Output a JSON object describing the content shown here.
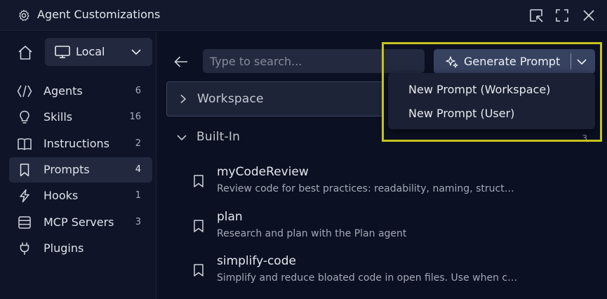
{
  "window": {
    "title": "Agent Customizations"
  },
  "sidebar": {
    "scope_label": "Local",
    "items": [
      {
        "label": "Agents",
        "count": "6",
        "icon": "agents-icon"
      },
      {
        "label": "Skills",
        "count": "16",
        "icon": "lightbulb-icon"
      },
      {
        "label": "Instructions",
        "count": "2",
        "icon": "book-icon"
      },
      {
        "label": "Prompts",
        "count": "4",
        "icon": "bookmark-icon",
        "active": true
      },
      {
        "label": "Hooks",
        "count": "1",
        "icon": "lightning-icon"
      },
      {
        "label": "MCP Servers",
        "count": "3",
        "icon": "server-icon"
      },
      {
        "label": "Plugins",
        "count": "",
        "icon": "plug-icon"
      }
    ]
  },
  "search": {
    "placeholder": "Type to search...",
    "value": ""
  },
  "generate_button": {
    "label": "Generate Prompt"
  },
  "dropdown_menu": {
    "items": [
      "New Prompt (Workspace)",
      "New Prompt (User)"
    ]
  },
  "groups": {
    "workspace": {
      "label": "Workspace"
    },
    "builtin": {
      "label": "Built-In",
      "count": "3"
    }
  },
  "prompts": [
    {
      "name": "myCodeReview",
      "description": "Review code for best practices: readability, naming, structure, and maintainability"
    },
    {
      "name": "plan",
      "description": "Research and plan with the Plan agent"
    },
    {
      "name": "simplify-code",
      "description": "Simplify and reduce bloated code in open files. Use when code feels too complex"
    }
  ],
  "colors": {
    "background": "#0b1022",
    "accent_button": "#374261",
    "highlight_border": "#c6c21c"
  }
}
